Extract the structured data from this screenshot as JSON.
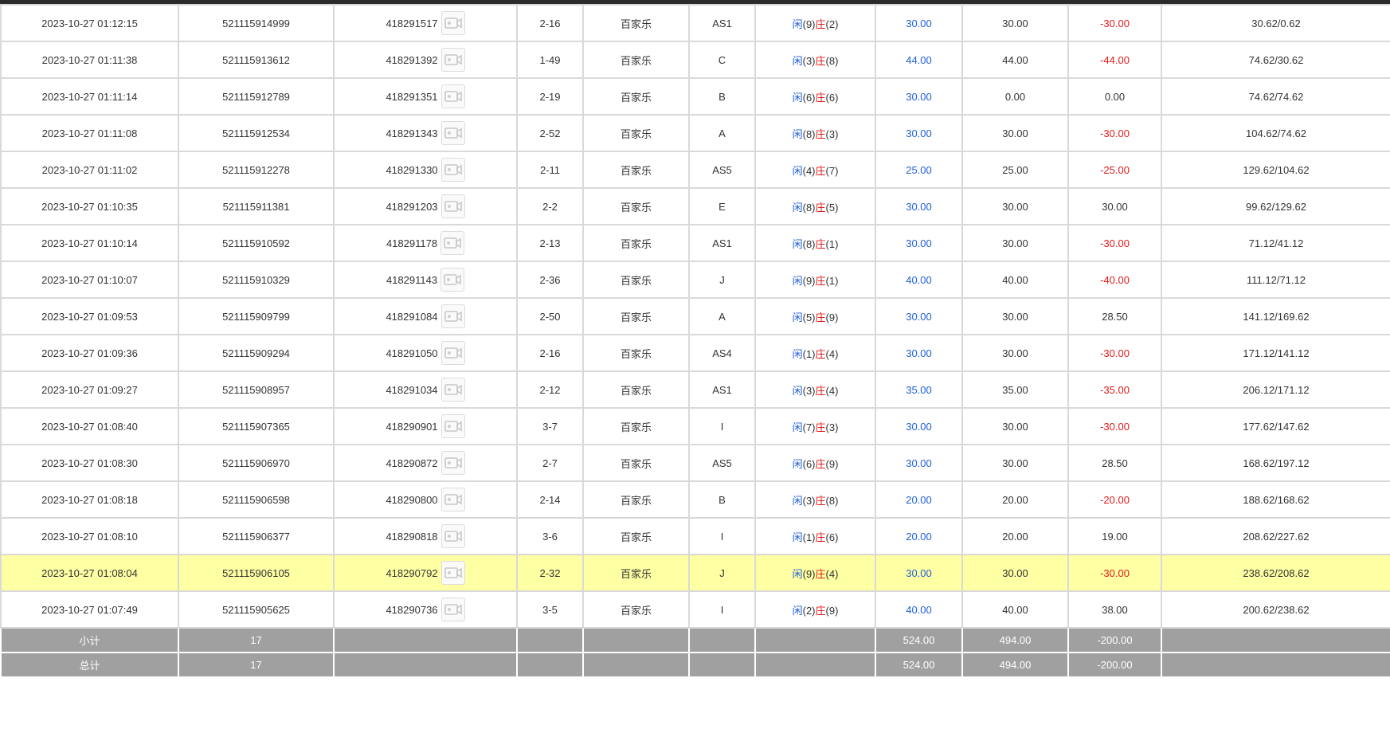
{
  "labels": {
    "xian": "闲",
    "zhuang": "庄"
  },
  "colors": {
    "blue": "#1f5fd6",
    "red": "#e21a1a",
    "highlight": "#ffffa3",
    "summary_bg": "#a0a0a0"
  },
  "icons": {
    "record": "video-record-icon"
  },
  "rows": [
    {
      "time": "2023-10-27 01:12:15",
      "order": "521115914999",
      "game_id": "418291517",
      "round": "2-16",
      "game": "百家乐",
      "table": "AS1",
      "xian": "(9)",
      "zhuang": "(2)",
      "bet": "30.00",
      "valid": "30.00",
      "result": "-30.00",
      "balance": "30.62/0.62"
    },
    {
      "time": "2023-10-27 01:11:38",
      "order": "521115913612",
      "game_id": "418291392",
      "round": "1-49",
      "game": "百家乐",
      "table": "C",
      "xian": "(3)",
      "zhuang": "(8)",
      "bet": "44.00",
      "valid": "44.00",
      "result": "-44.00",
      "balance": "74.62/30.62"
    },
    {
      "time": "2023-10-27 01:11:14",
      "order": "521115912789",
      "game_id": "418291351",
      "round": "2-19",
      "game": "百家乐",
      "table": "B",
      "xian": "(6)",
      "zhuang": "(6)",
      "bet": "30.00",
      "valid": "0.00",
      "result": "0.00",
      "balance": "74.62/74.62"
    },
    {
      "time": "2023-10-27 01:11:08",
      "order": "521115912534",
      "game_id": "418291343",
      "round": "2-52",
      "game": "百家乐",
      "table": "A",
      "xian": "(8)",
      "zhuang": "(3)",
      "bet": "30.00",
      "valid": "30.00",
      "result": "-30.00",
      "balance": "104.62/74.62"
    },
    {
      "time": "2023-10-27 01:11:02",
      "order": "521115912278",
      "game_id": "418291330",
      "round": "2-11",
      "game": "百家乐",
      "table": "AS5",
      "xian": "(4)",
      "zhuang": "(7)",
      "bet": "25.00",
      "valid": "25.00",
      "result": "-25.00",
      "balance": "129.62/104.62"
    },
    {
      "time": "2023-10-27 01:10:35",
      "order": "521115911381",
      "game_id": "418291203",
      "round": "2-2",
      "game": "百家乐",
      "table": "E",
      "xian": "(8)",
      "zhuang": "(5)",
      "bet": "30.00",
      "valid": "30.00",
      "result": "30.00",
      "balance": "99.62/129.62"
    },
    {
      "time": "2023-10-27 01:10:14",
      "order": "521115910592",
      "game_id": "418291178",
      "round": "2-13",
      "game": "百家乐",
      "table": "AS1",
      "xian": "(8)",
      "zhuang": "(1)",
      "bet": "30.00",
      "valid": "30.00",
      "result": "-30.00",
      "balance": "71.12/41.12"
    },
    {
      "time": "2023-10-27 01:10:07",
      "order": "521115910329",
      "game_id": "418291143",
      "round": "2-36",
      "game": "百家乐",
      "table": "J",
      "xian": "(9)",
      "zhuang": "(1)",
      "bet": "40.00",
      "valid": "40.00",
      "result": "-40.00",
      "balance": "111.12/71.12"
    },
    {
      "time": "2023-10-27 01:09:53",
      "order": "521115909799",
      "game_id": "418291084",
      "round": "2-50",
      "game": "百家乐",
      "table": "A",
      "xian": "(5)",
      "zhuang": "(9)",
      "bet": "30.00",
      "valid": "30.00",
      "result": "28.50",
      "balance": "141.12/169.62"
    },
    {
      "time": "2023-10-27 01:09:36",
      "order": "521115909294",
      "game_id": "418291050",
      "round": "2-16",
      "game": "百家乐",
      "table": "AS4",
      "xian": "(1)",
      "zhuang": "(4)",
      "bet": "30.00",
      "valid": "30.00",
      "result": "-30.00",
      "balance": "171.12/141.12"
    },
    {
      "time": "2023-10-27 01:09:27",
      "order": "521115908957",
      "game_id": "418291034",
      "round": "2-12",
      "game": "百家乐",
      "table": "AS1",
      "xian": "(3)",
      "zhuang": "(4)",
      "bet": "35.00",
      "valid": "35.00",
      "result": "-35.00",
      "balance": "206.12/171.12"
    },
    {
      "time": "2023-10-27 01:08:40",
      "order": "521115907365",
      "game_id": "418290901",
      "round": "3-7",
      "game": "百家乐",
      "table": "I",
      "xian": "(7)",
      "zhuang": "(3)",
      "bet": "30.00",
      "valid": "30.00",
      "result": "-30.00",
      "balance": "177.62/147.62"
    },
    {
      "time": "2023-10-27 01:08:30",
      "order": "521115906970",
      "game_id": "418290872",
      "round": "2-7",
      "game": "百家乐",
      "table": "AS5",
      "xian": "(6)",
      "zhuang": "(9)",
      "bet": "30.00",
      "valid": "30.00",
      "result": "28.50",
      "balance": "168.62/197.12"
    },
    {
      "time": "2023-10-27 01:08:18",
      "order": "521115906598",
      "game_id": "418290800",
      "round": "2-14",
      "game": "百家乐",
      "table": "B",
      "xian": "(3)",
      "zhuang": "(8)",
      "bet": "20.00",
      "valid": "20.00",
      "result": "-20.00",
      "balance": "188.62/168.62"
    },
    {
      "time": "2023-10-27 01:08:10",
      "order": "521115906377",
      "game_id": "418290818",
      "round": "3-6",
      "game": "百家乐",
      "table": "I",
      "xian": "(1)",
      "zhuang": "(6)",
      "bet": "20.00",
      "valid": "20.00",
      "result": "19.00",
      "balance": "208.62/227.62"
    },
    {
      "time": "2023-10-27 01:08:04",
      "order": "521115906105",
      "game_id": "418290792",
      "round": "2-32",
      "game": "百家乐",
      "table": "J",
      "xian": "(9)",
      "zhuang": "(4)",
      "bet": "30.00",
      "valid": "30.00",
      "result": "-30.00",
      "balance": "238.62/208.62",
      "highlight": true
    },
    {
      "time": "2023-10-27 01:07:49",
      "order": "521115905625",
      "game_id": "418290736",
      "round": "3-5",
      "game": "百家乐",
      "table": "I",
      "xian": "(2)",
      "zhuang": "(9)",
      "bet": "40.00",
      "valid": "40.00",
      "result": "38.00",
      "balance": "200.62/238.62"
    }
  ],
  "summary": [
    {
      "label": "小计",
      "count": "17",
      "bet": "524.00",
      "valid": "494.00",
      "result": "-200.00"
    },
    {
      "label": "总计",
      "count": "17",
      "bet": "524.00",
      "valid": "494.00",
      "result": "-200.00"
    }
  ]
}
